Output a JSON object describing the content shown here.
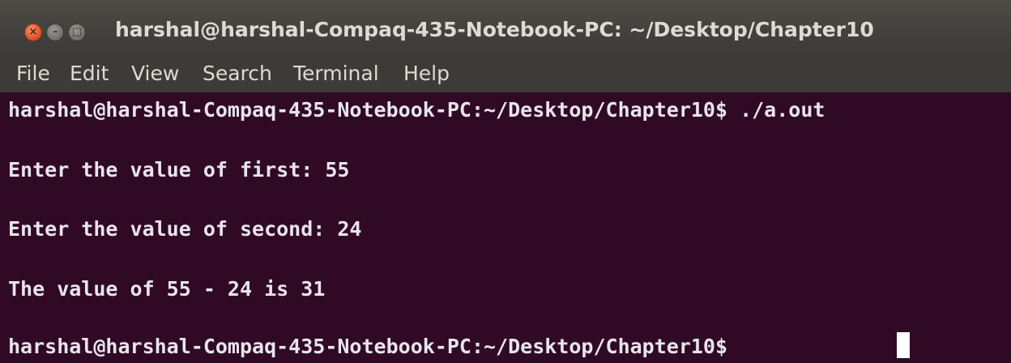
{
  "window": {
    "title": "harshal@harshal-Compaq-435-Notebook-PC: ~/Desktop/Chapter10",
    "controls": {
      "close_glyph": "×",
      "minimize_glyph": "–",
      "maximize_glyph": "□"
    }
  },
  "menu": {
    "items": [
      "File",
      "Edit",
      "View",
      "Search",
      "Terminal",
      "Help"
    ]
  },
  "terminal": {
    "lines": [
      "harshal@harshal-Compaq-435-Notebook-PC:~/Desktop/Chapter10$ ./a.out",
      "Enter the value of first: 55",
      "Enter the value of second: 24",
      "The value of 55 - 24 is 31",
      "harshal@harshal-Compaq-435-Notebook-PC:~/Desktop/Chapter10$ "
    ]
  },
  "colors": {
    "terminal_background": "#300a24",
    "terminal_text": "#e8e4ee",
    "titlebar": "#3c3b37",
    "close_button": "#e0552b"
  },
  "icons": {
    "close": "close-icon",
    "minimize": "minimize-icon",
    "maximize": "maximize-icon"
  }
}
